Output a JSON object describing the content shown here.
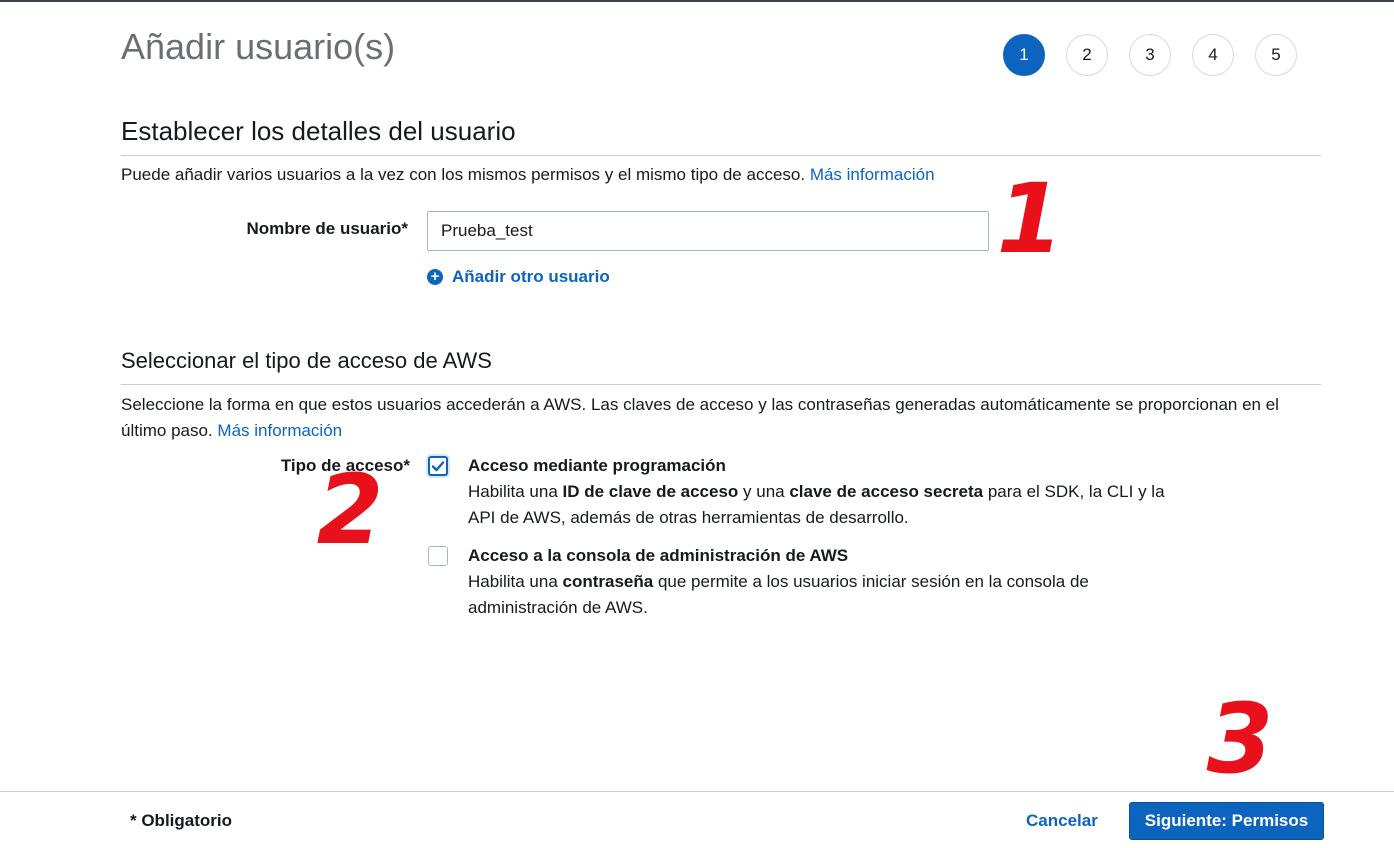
{
  "header": {
    "title": "Añadir usuario(s)",
    "steps": [
      "1",
      "2",
      "3",
      "4",
      "5"
    ],
    "active_step": 1
  },
  "user_details": {
    "title": "Establecer los detalles del usuario",
    "description": "Puede añadir varios usuarios a la vez con los mismos permisos y el mismo tipo de acceso.",
    "more_info_link": "Más información",
    "username_label": "Nombre de usuario*",
    "username_value": "Prueba_test",
    "add_user_link": "Añadir otro usuario"
  },
  "access_type": {
    "title": "Seleccionar el tipo de acceso de AWS",
    "description": "Seleccione la forma en que estos usuarios accederán a AWS. Las claves de acceso y las contraseñas generadas automáticamente se proporcionan en el último paso.",
    "more_info_link": "Más información",
    "label": "Tipo de acceso*",
    "options": [
      {
        "title": "Acceso mediante programación",
        "checked": true,
        "desc_parts": [
          "Habilita una ",
          "ID de clave de acceso",
          " y una ",
          "clave de acceso secreta",
          " para el SDK, la CLI y la API de AWS, además de otras herramientas de desarrollo."
        ]
      },
      {
        "title": "Acceso a la consola de administración de AWS",
        "checked": false,
        "desc_parts": [
          "Habilita una ",
          "contraseña",
          " que permite a los usuarios iniciar sesión en la consola de administración de AWS."
        ]
      }
    ]
  },
  "footer": {
    "required_note": "* Obligatorio",
    "cancel_label": "Cancelar",
    "next_label": "Siguiente: Permisos"
  },
  "colors": {
    "primary": "#0d64bf",
    "annotation": "#e8101a"
  },
  "annotations": [
    "1",
    "2",
    "3"
  ]
}
